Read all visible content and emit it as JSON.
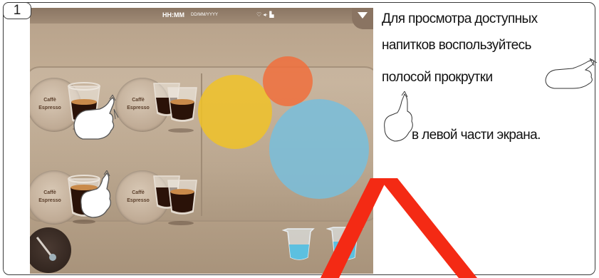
{
  "step_number": "1",
  "screen": {
    "status_time": "HH:MM",
    "status_date": "DD/MM/YYYY",
    "drinks": [
      {
        "line1": "Caffè",
        "line2": "Espresso"
      },
      {
        "line1": "Caffè",
        "line2": "Espresso"
      },
      {
        "line1": "Caffè",
        "line2": "Espresso"
      },
      {
        "line1": "Caffè",
        "line2": "Espresso"
      }
    ],
    "bubble_colors": [
      "#f0c228",
      "#f06e3c",
      "#78bedc"
    ]
  },
  "instruction": {
    "line1": "Для просмотра доступных",
    "line2": "напитков воспользуйтесь",
    "line3": "полосой прокрутки",
    "line4": "в левой части экрана."
  }
}
